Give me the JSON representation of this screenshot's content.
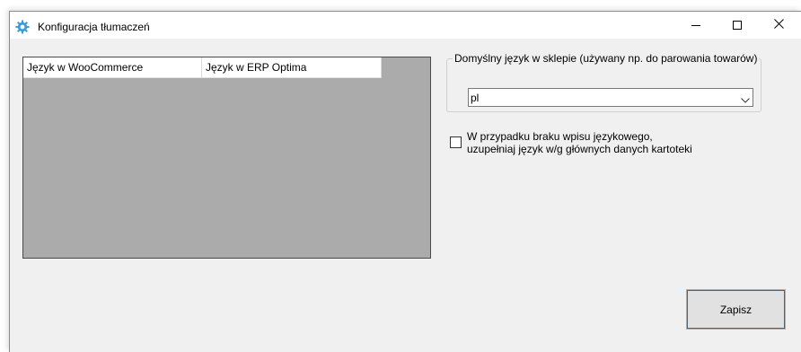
{
  "window": {
    "title": "Konfiguracja tłumaczeń",
    "icon": "gear-icon"
  },
  "grid": {
    "columns": [
      "Język w WooCommerce",
      "Język w ERP Optima"
    ]
  },
  "default_language": {
    "legend": "Domyślny język w sklepie (używany np. do parowania towarów)",
    "value": "pl"
  },
  "fill_checkbox": {
    "checked": false,
    "label_line1": "W przypadku braku wpisu językowego,",
    "label_line2": "uzupełniaj język w/g głównych danych kartoteki"
  },
  "save_label": "Zapisz",
  "colors": {
    "accent": "#0078d7",
    "grid_bg": "#ababab",
    "window_bg": "#f0f0f0",
    "icon": "#3a9bd9"
  }
}
